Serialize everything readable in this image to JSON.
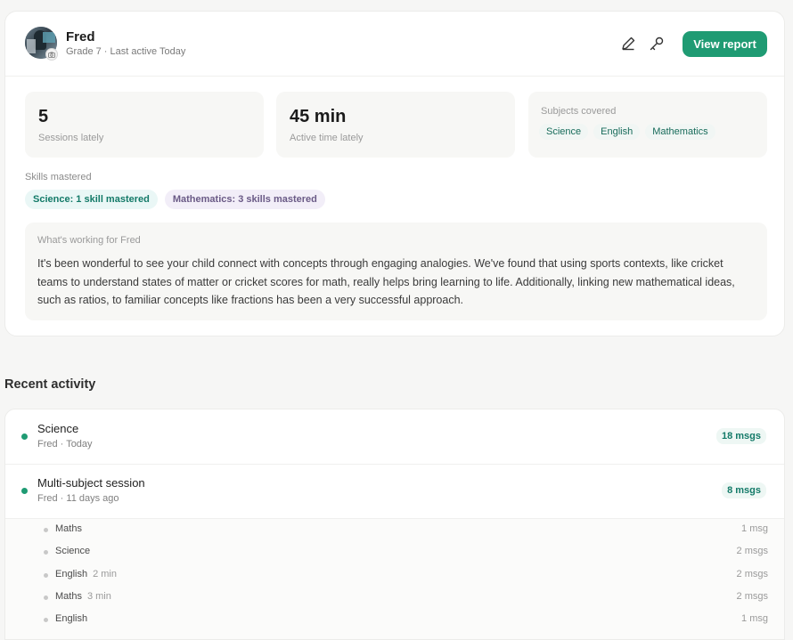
{
  "profile": {
    "name": "Fred",
    "subline": "Grade 7 · Last active Today",
    "view_report_label": "View report"
  },
  "stats": {
    "sessions_value": "5",
    "sessions_label": "Sessions lately",
    "active_value": "45 min",
    "active_label": "Active time lately",
    "subjects_label": "Subjects covered",
    "subjects": [
      "Science",
      "English",
      "Mathematics"
    ]
  },
  "skills": {
    "label": "Skills mastered",
    "items": [
      "Science: 1 skill mastered",
      "Mathematics: 3 skills mastered"
    ]
  },
  "working": {
    "title": "What's working for Fred",
    "text": "It's been wonderful to see your child connect with concepts through engaging analogies. We've found that using sports contexts, like cricket teams to understand states of matter or cricket scores for math, really helps bring learning to life. Additionally, linking new mathematical ideas, such as ratios, to familiar concepts like fractions has been a very successful approach."
  },
  "recent": {
    "title": "Recent activity",
    "sessions": [
      {
        "title": "Science",
        "sub": "Fred · Today",
        "msgs": "18 msgs"
      },
      {
        "title": "Multi-subject session",
        "sub": "Fred · 11 days ago",
        "msgs": "8 msgs"
      }
    ],
    "subitems": [
      {
        "name": "Maths",
        "duration": "",
        "msgs": "1 msg"
      },
      {
        "name": "Science",
        "duration": "",
        "msgs": "2 msgs"
      },
      {
        "name": "English",
        "duration": "2 min",
        "msgs": "2 msgs"
      },
      {
        "name": "Maths",
        "duration": "3 min",
        "msgs": "2 msgs"
      },
      {
        "name": "English",
        "duration": "",
        "msgs": "1 msg"
      }
    ]
  },
  "icons": {
    "edit": "pencil-icon",
    "key": "key-icon",
    "camera": "camera-icon"
  },
  "colors": {
    "accent": "#1f9b73",
    "accent_text": "#137a68"
  }
}
